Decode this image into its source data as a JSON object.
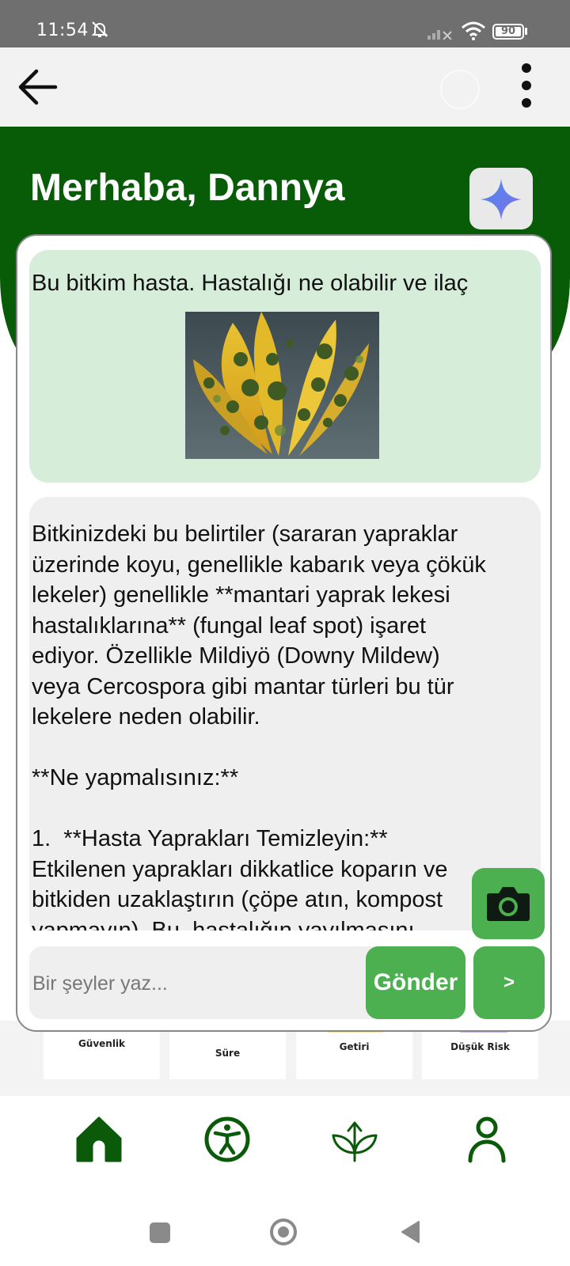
{
  "status_bar": {
    "time": "11:54",
    "battery": "90"
  },
  "header": {
    "greeting": "Merhaba, Dannya"
  },
  "chat": {
    "user_message": "Bu bitkim hasta. Hastalığı ne olabilir ve ilaç",
    "bot_message": "Bitkinizdeki bu belirtiler (sararan yapraklar\nüzerinde koyu, genellikle kabarık veya çökük\nlekeler) genellikle **mantari yaprak lekesi\nhastalıklarına** (fungal leaf spot) işaret\nediyor. Özellikle Mildiyö (Downy Mildew)\nveya Cercospora gibi mantar türleri bu tür\nlekelere neden olabilir.\n\n**Ne yapmalısınız:**\n\n1.  **Hasta Yaprakları Temizleyin:**\nEtkilenen yaprakları dikkatlice koparın ve\nbitkiden uzaklaştırın (çöpe atın, kompost\nyapmayın). Bu, hastalığın yayılmasını"
  },
  "input": {
    "placeholder": "Bir şeyler yaz...",
    "send_label": "Gönder",
    "next_label": ">"
  },
  "stats": [
    "Güvenlik",
    "Süre",
    "Getiri",
    "Düşük Risk"
  ],
  "colors": {
    "header_green": "#085c08",
    "accent_green": "#4caf50",
    "user_bubble": "#d5edd9",
    "bot_bubble": "#efefef"
  },
  "icons": {
    "back": "arrow-left-icon",
    "more": "more-vert-icon",
    "ai": "sparkle-icon",
    "camera": "camera-icon",
    "nav": [
      "home-icon",
      "accessibility-icon",
      "plant-growth-icon",
      "profile-icon"
    ]
  }
}
